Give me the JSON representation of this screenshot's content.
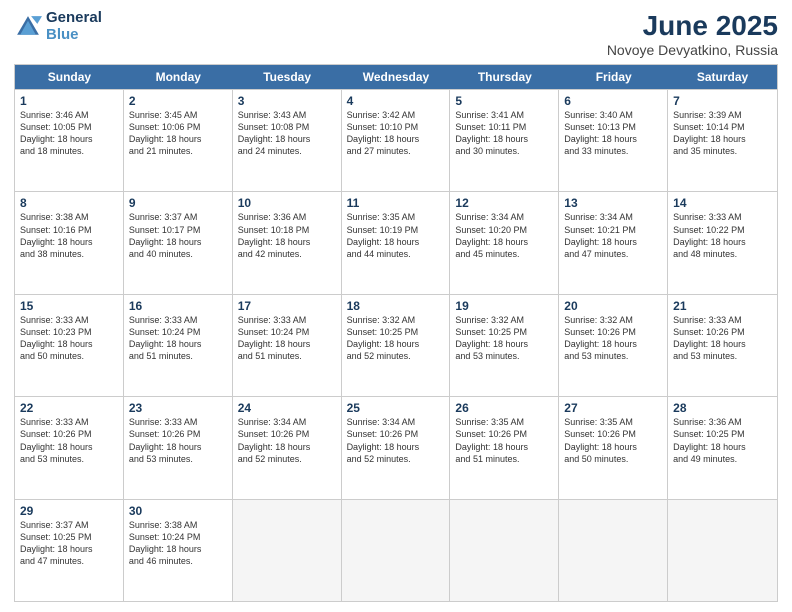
{
  "header": {
    "logo_line1": "General",
    "logo_line2": "Blue",
    "month": "June 2025",
    "location": "Novoye Devyatkino, Russia"
  },
  "days_of_week": [
    "Sunday",
    "Monday",
    "Tuesday",
    "Wednesday",
    "Thursday",
    "Friday",
    "Saturday"
  ],
  "weeks": [
    [
      {
        "day": "1",
        "lines": [
          "Sunrise: 3:46 AM",
          "Sunset: 10:05 PM",
          "Daylight: 18 hours",
          "and 18 minutes."
        ]
      },
      {
        "day": "2",
        "lines": [
          "Sunrise: 3:45 AM",
          "Sunset: 10:06 PM",
          "Daylight: 18 hours",
          "and 21 minutes."
        ]
      },
      {
        "day": "3",
        "lines": [
          "Sunrise: 3:43 AM",
          "Sunset: 10:08 PM",
          "Daylight: 18 hours",
          "and 24 minutes."
        ]
      },
      {
        "day": "4",
        "lines": [
          "Sunrise: 3:42 AM",
          "Sunset: 10:10 PM",
          "Daylight: 18 hours",
          "and 27 minutes."
        ]
      },
      {
        "day": "5",
        "lines": [
          "Sunrise: 3:41 AM",
          "Sunset: 10:11 PM",
          "Daylight: 18 hours",
          "and 30 minutes."
        ]
      },
      {
        "day": "6",
        "lines": [
          "Sunrise: 3:40 AM",
          "Sunset: 10:13 PM",
          "Daylight: 18 hours",
          "and 33 minutes."
        ]
      },
      {
        "day": "7",
        "lines": [
          "Sunrise: 3:39 AM",
          "Sunset: 10:14 PM",
          "Daylight: 18 hours",
          "and 35 minutes."
        ]
      }
    ],
    [
      {
        "day": "8",
        "lines": [
          "Sunrise: 3:38 AM",
          "Sunset: 10:16 PM",
          "Daylight: 18 hours",
          "and 38 minutes."
        ]
      },
      {
        "day": "9",
        "lines": [
          "Sunrise: 3:37 AM",
          "Sunset: 10:17 PM",
          "Daylight: 18 hours",
          "and 40 minutes."
        ]
      },
      {
        "day": "10",
        "lines": [
          "Sunrise: 3:36 AM",
          "Sunset: 10:18 PM",
          "Daylight: 18 hours",
          "and 42 minutes."
        ]
      },
      {
        "day": "11",
        "lines": [
          "Sunrise: 3:35 AM",
          "Sunset: 10:19 PM",
          "Daylight: 18 hours",
          "and 44 minutes."
        ]
      },
      {
        "day": "12",
        "lines": [
          "Sunrise: 3:34 AM",
          "Sunset: 10:20 PM",
          "Daylight: 18 hours",
          "and 45 minutes."
        ]
      },
      {
        "day": "13",
        "lines": [
          "Sunrise: 3:34 AM",
          "Sunset: 10:21 PM",
          "Daylight: 18 hours",
          "and 47 minutes."
        ]
      },
      {
        "day": "14",
        "lines": [
          "Sunrise: 3:33 AM",
          "Sunset: 10:22 PM",
          "Daylight: 18 hours",
          "and 48 minutes."
        ]
      }
    ],
    [
      {
        "day": "15",
        "lines": [
          "Sunrise: 3:33 AM",
          "Sunset: 10:23 PM",
          "Daylight: 18 hours",
          "and 50 minutes."
        ]
      },
      {
        "day": "16",
        "lines": [
          "Sunrise: 3:33 AM",
          "Sunset: 10:24 PM",
          "Daylight: 18 hours",
          "and 51 minutes."
        ]
      },
      {
        "day": "17",
        "lines": [
          "Sunrise: 3:33 AM",
          "Sunset: 10:24 PM",
          "Daylight: 18 hours",
          "and 51 minutes."
        ]
      },
      {
        "day": "18",
        "lines": [
          "Sunrise: 3:32 AM",
          "Sunset: 10:25 PM",
          "Daylight: 18 hours",
          "and 52 minutes."
        ]
      },
      {
        "day": "19",
        "lines": [
          "Sunrise: 3:32 AM",
          "Sunset: 10:25 PM",
          "Daylight: 18 hours",
          "and 53 minutes."
        ]
      },
      {
        "day": "20",
        "lines": [
          "Sunrise: 3:32 AM",
          "Sunset: 10:26 PM",
          "Daylight: 18 hours",
          "and 53 minutes."
        ]
      },
      {
        "day": "21",
        "lines": [
          "Sunrise: 3:33 AM",
          "Sunset: 10:26 PM",
          "Daylight: 18 hours",
          "and 53 minutes."
        ]
      }
    ],
    [
      {
        "day": "22",
        "lines": [
          "Sunrise: 3:33 AM",
          "Sunset: 10:26 PM",
          "Daylight: 18 hours",
          "and 53 minutes."
        ]
      },
      {
        "day": "23",
        "lines": [
          "Sunrise: 3:33 AM",
          "Sunset: 10:26 PM",
          "Daylight: 18 hours",
          "and 53 minutes."
        ]
      },
      {
        "day": "24",
        "lines": [
          "Sunrise: 3:34 AM",
          "Sunset: 10:26 PM",
          "Daylight: 18 hours",
          "and 52 minutes."
        ]
      },
      {
        "day": "25",
        "lines": [
          "Sunrise: 3:34 AM",
          "Sunset: 10:26 PM",
          "Daylight: 18 hours",
          "and 52 minutes."
        ]
      },
      {
        "day": "26",
        "lines": [
          "Sunrise: 3:35 AM",
          "Sunset: 10:26 PM",
          "Daylight: 18 hours",
          "and 51 minutes."
        ]
      },
      {
        "day": "27",
        "lines": [
          "Sunrise: 3:35 AM",
          "Sunset: 10:26 PM",
          "Daylight: 18 hours",
          "and 50 minutes."
        ]
      },
      {
        "day": "28",
        "lines": [
          "Sunrise: 3:36 AM",
          "Sunset: 10:25 PM",
          "Daylight: 18 hours",
          "and 49 minutes."
        ]
      }
    ],
    [
      {
        "day": "29",
        "lines": [
          "Sunrise: 3:37 AM",
          "Sunset: 10:25 PM",
          "Daylight: 18 hours",
          "and 47 minutes."
        ]
      },
      {
        "day": "30",
        "lines": [
          "Sunrise: 3:38 AM",
          "Sunset: 10:24 PM",
          "Daylight: 18 hours",
          "and 46 minutes."
        ]
      },
      {
        "day": "",
        "lines": []
      },
      {
        "day": "",
        "lines": []
      },
      {
        "day": "",
        "lines": []
      },
      {
        "day": "",
        "lines": []
      },
      {
        "day": "",
        "lines": []
      }
    ]
  ]
}
